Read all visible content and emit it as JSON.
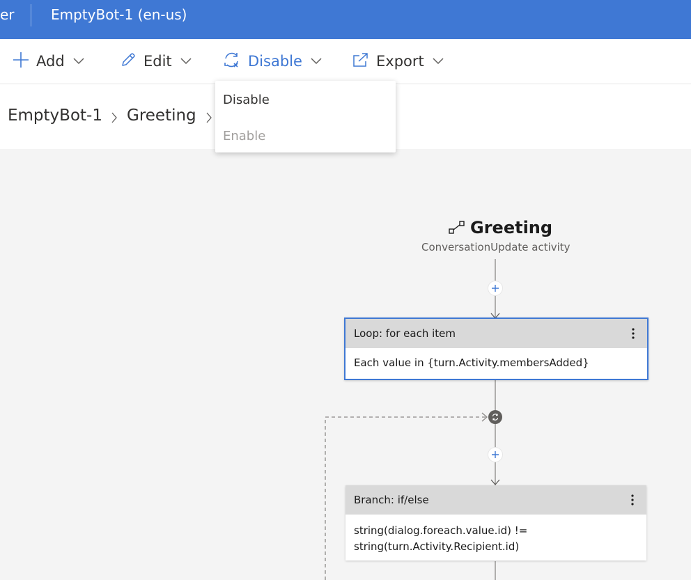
{
  "topbar": {
    "app_name_fragment": "er",
    "bot_title": "EmptyBot-1 (en-us)"
  },
  "toolbar": {
    "add_label": "Add",
    "edit_label": "Edit",
    "disable_label": "Disable",
    "export_label": "Export"
  },
  "breadcrumb": {
    "items": [
      "EmptyBot-1",
      "Greeting"
    ]
  },
  "dropdown": {
    "items": [
      {
        "label": "Disable",
        "enabled": true
      },
      {
        "label": "Enable",
        "enabled": false
      }
    ]
  },
  "flow": {
    "trigger": {
      "title": "Greeting",
      "subtitle": "ConversationUpdate activity"
    },
    "nodes": [
      {
        "header": "Loop: for each item",
        "body": "Each value in {turn.Activity.membersAdded}",
        "selected": true
      },
      {
        "header": "Branch: if/else",
        "body_line1": "string(dialog.foreach.value.id) !=",
        "body_line2": "string(turn.Activity.Recipient.id)",
        "selected": false
      }
    ]
  },
  "colors": {
    "accent": "#3f78d4",
    "card_header": "#d9d9d9",
    "canvas": "#f4f4f4",
    "disabled_text": "#a19f9d"
  },
  "icons": {
    "add": "plus-icon",
    "edit": "pencil-icon",
    "disable": "sync-icon",
    "export": "export-icon",
    "trigger": "trigger-icon",
    "more": "more-vertical-icon"
  }
}
